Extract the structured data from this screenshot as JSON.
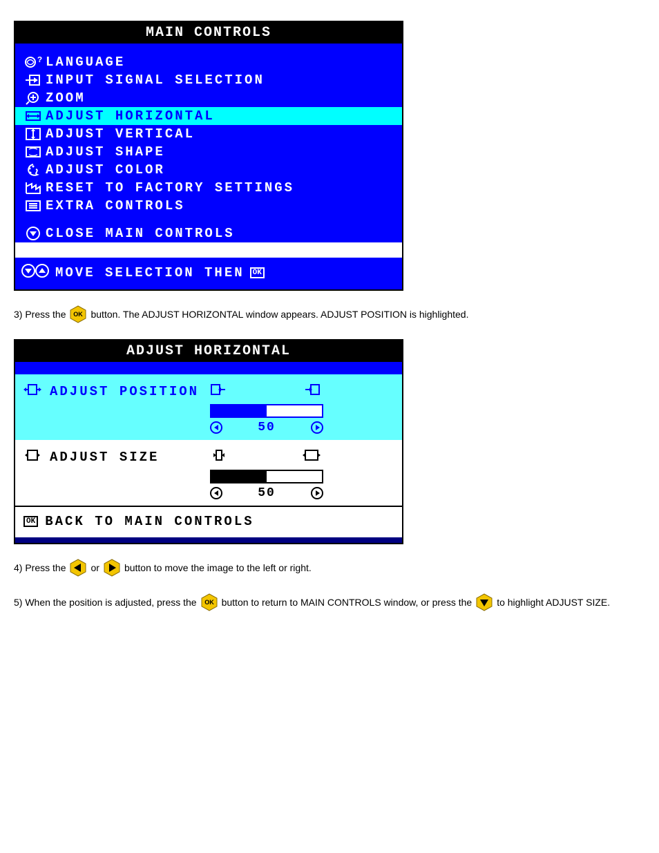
{
  "panel1": {
    "title": "MAIN CONTROLS",
    "items": [
      {
        "id": "language",
        "label": "LANGUAGE",
        "icon": "globe-question",
        "selected": false
      },
      {
        "id": "input",
        "label": "INPUT SIGNAL SELECTION",
        "icon": "arrow-in-box",
        "selected": false
      },
      {
        "id": "zoom",
        "label": "ZOOM",
        "icon": "magnifier-plus",
        "selected": false
      },
      {
        "id": "adj-h",
        "label": "ADJUST HORIZONTAL",
        "icon": "h-arrows-box",
        "selected": true
      },
      {
        "id": "adj-v",
        "label": "ADJUST VERTICAL",
        "icon": "v-arrows-box",
        "selected": false
      },
      {
        "id": "adj-shape",
        "label": "ADJUST SHAPE",
        "icon": "shape-box",
        "selected": false
      },
      {
        "id": "adj-color",
        "label": "ADJUST COLOR",
        "icon": "palette",
        "selected": false
      },
      {
        "id": "reset",
        "label": "RESET TO FACTORY SETTINGS",
        "icon": "factory",
        "selected": false
      },
      {
        "id": "extra",
        "label": "EXTRA CONTROLS",
        "icon": "list-box",
        "selected": false
      }
    ],
    "close_label": "CLOSE MAIN CONTROLS",
    "footer_label": "MOVE SELECTION THEN"
  },
  "instructions": {
    "step3_pre": "3) Press the ",
    "step3_post": " button. The ADJUST HORIZONTAL window appears. ADJUST POSITION is highlighted.",
    "step4_pre": "4) Press the ",
    "step4_mid": " or ",
    "step4_post": " button to move the image to the left or right.",
    "step5_pre": "5) When the position is adjusted, press the ",
    "step5_mid": " button to return to MAIN CONTROLS window, or press the ",
    "step5_post": " to highlight ADJUST SIZE."
  },
  "panel2": {
    "title": "ADJUST HORIZONTAL",
    "items": [
      {
        "id": "position",
        "label": "ADJUST POSITION",
        "value": 50,
        "selected": true
      },
      {
        "id": "size",
        "label": "ADJUST SIZE",
        "value": 50,
        "selected": false
      }
    ],
    "back_label": "BACK TO MAIN CONTROLS"
  }
}
